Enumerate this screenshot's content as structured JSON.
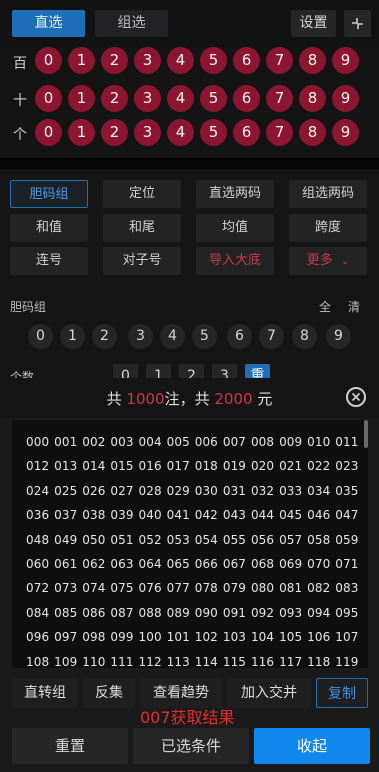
{
  "top": {
    "tabs": [
      {
        "label": "直选",
        "active": true
      },
      {
        "label": "组选",
        "active": false
      }
    ],
    "settings_label": "设置",
    "collapse_icon": "compress-icon"
  },
  "digit_rows": [
    {
      "label": "百",
      "digits": [
        "0",
        "1",
        "2",
        "3",
        "4",
        "5",
        "6",
        "7",
        "8",
        "9"
      ]
    },
    {
      "label": "十",
      "digits": [
        "0",
        "1",
        "2",
        "3",
        "4",
        "5",
        "6",
        "7",
        "8",
        "9"
      ]
    },
    {
      "label": "个",
      "digits": [
        "0",
        "1",
        "2",
        "3",
        "4",
        "5",
        "6",
        "7",
        "8",
        "9"
      ]
    }
  ],
  "filters": {
    "row1": [
      "胆码组",
      "定位",
      "直选两码",
      "组选两码"
    ],
    "row2": [
      "和值",
      "和尾",
      "均值",
      "跨度"
    ],
    "row3": [
      "连号",
      "对子号",
      "导入大底",
      "更多"
    ],
    "more_icon": "chevron-down-icon"
  },
  "dan_section": {
    "label": "胆码组",
    "all_label": "全",
    "clear_label": "清",
    "digits": [
      "0",
      "1",
      "2",
      "3",
      "4",
      "5",
      "6",
      "7",
      "8",
      "9"
    ]
  },
  "count_section": {
    "label": "个数",
    "values": [
      "0",
      "1",
      "2",
      "3",
      "重"
    ]
  },
  "popup": {
    "summary_prefix": "共",
    "count": "1000",
    "summary_mid": "注，共",
    "amount": "2000",
    "summary_suffix": "元",
    "numbers": "000 001 002 003 004 005 006 007 008 009 010 011 012 013 014 015 016 017 018 019 020 021 022 023 024 025 026 027 028 029 030 031 032 033 034 035 036 037 038 039 040 041 042 043 044 045 046 047 048 049 050 051 052 053 054 055 056 057 058 059 060 061 062 063 064 065 066 067 068 069 070 071 072 073 074 075 076 077 078 079 080 081 082 083 084 085 086 087 088 089 090 091 092 093 094 095 096 097 098 099 100 101 102 103 104 105 106 107 108 109 110 111 112 113 114 115 116 117 118 119",
    "actions": [
      "直转组",
      "反集",
      "查看趋势",
      "加入交并",
      "复制"
    ],
    "result_text": "007获取结果"
  },
  "bottom": {
    "reset_label": "重置",
    "conditions_label": "已选条件",
    "fold_label": "收起"
  },
  "colors": {
    "accent": "#1f6fb8",
    "ball_red": "#8c1530",
    "highlight_red": "#d2354a",
    "primary_blue": "#1188ee"
  }
}
